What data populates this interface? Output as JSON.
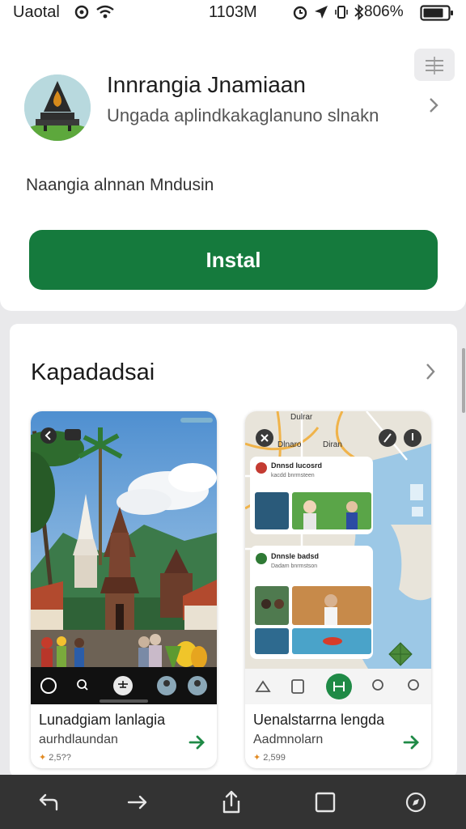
{
  "status_bar": {
    "carrier": "Uaotal",
    "time": "1103M",
    "battery": "806%"
  },
  "app": {
    "title": "Innrangia Jnamiaan",
    "subtitle": "Ungada aplindkakaglanuno slnakn",
    "description": "Naangia alnnan Mndusin",
    "install_label": "Instal"
  },
  "section": {
    "title": "Kapadadsai",
    "cards": [
      {
        "title": "Lunadgiam lanlagia",
        "subtitle": "aurhdlaundan",
        "meta": "2,5??",
        "type": "temple-photo"
      },
      {
        "title": "Uenalstarrna lengda",
        "subtitle": "Aadmnolarn",
        "meta": "2,599",
        "type": "map-view",
        "map_chips": [
          "Dulrar",
          "Dlnaro",
          "Diran"
        ],
        "map_posts": [
          {
            "title": "Dnnsd lucosrd",
            "line": "kacdd bnrmsteen"
          },
          {
            "title": "Dnnsle badsd",
            "line": "Dadam bnrmstson"
          }
        ]
      }
    ]
  },
  "colors": {
    "accent": "#157a3d",
    "bottom_bar": "#333333",
    "meta_star": "#e28a22"
  },
  "icons": [
    "wifi-icon",
    "battery-icon",
    "bluetooth-icon",
    "filter-icon",
    "chevron-right-icon",
    "arrow-right-icon",
    "back-icon",
    "forward-icon",
    "share-icon",
    "tabs-icon",
    "compass-icon"
  ]
}
